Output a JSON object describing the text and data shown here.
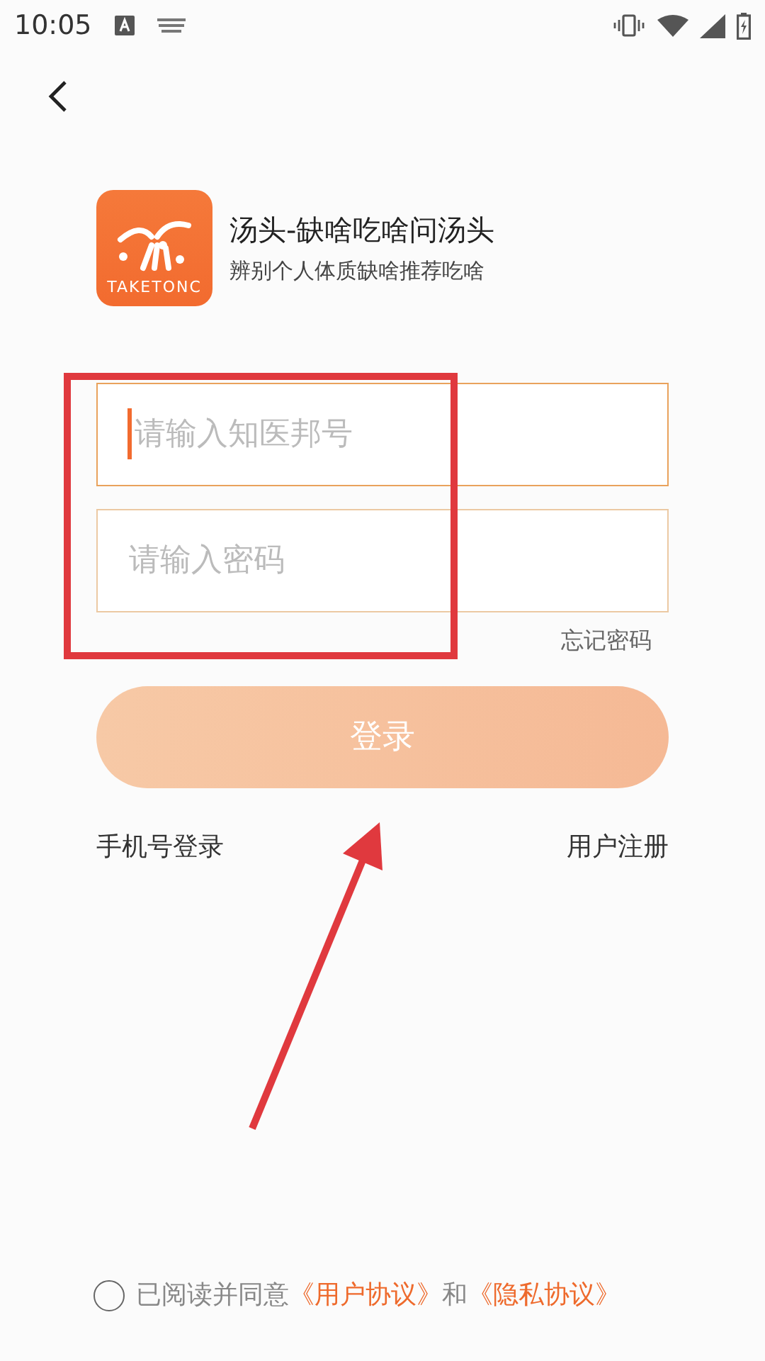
{
  "status_bar": {
    "time": "10:05"
  },
  "app": {
    "logo_text": "TAKETONC",
    "title": "汤头-缺啥吃啥问汤头",
    "subtitle": "辨别个人体质缺啥推荐吃啥"
  },
  "fields": [
    {
      "placeholder": "请输入知医邦号",
      "focused": true
    },
    {
      "placeholder": "请输入密码",
      "focused": false
    }
  ],
  "forgot_password": "忘记密码",
  "login_button": {
    "label": "登录",
    "disabled": true
  },
  "links": [
    "手机号登录",
    "用户注册"
  ],
  "agreement": {
    "checked": false,
    "parts": [
      {
        "kind": "plain",
        "text": "已阅读并同意"
      },
      {
        "kind": "link",
        "text": "《用户协议》"
      },
      {
        "kind": "plain",
        "text": "和"
      },
      {
        "kind": "link",
        "text": "《隐私协议》"
      }
    ]
  }
}
